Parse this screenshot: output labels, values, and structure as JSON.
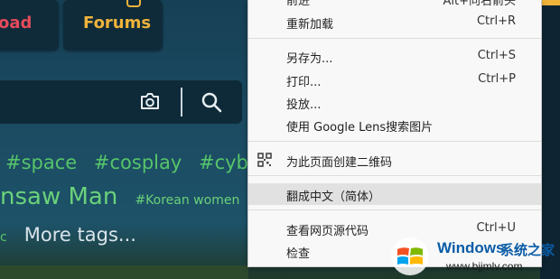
{
  "colors": {
    "page_bg": "#164055",
    "tag_green": "#56c46a",
    "menu_bg": "#f8f8f8",
    "menu_highlight": "#e1e1e1",
    "brand_blue": "#0a5ca6"
  },
  "nav_tiles": {
    "load_label": "oad",
    "forums_label": "Forums"
  },
  "tags": {
    "row1": [
      "#space",
      "#cosplay",
      "#cyberp"
    ],
    "row2_big": "nsaw Man",
    "row2_small": "#Korean women",
    "row3_small": "c",
    "more": "More tags..."
  },
  "context_menu": {
    "partial_top": {
      "label": "前进",
      "shortcut": "Alt+向右箭头"
    },
    "items": [
      {
        "label": "重新加载",
        "shortcut": "Ctrl+R"
      },
      {
        "label": "另存为...",
        "shortcut": "Ctrl+S"
      },
      {
        "label": "打印...",
        "shortcut": "Ctrl+P"
      },
      {
        "label": "投放...",
        "shortcut": ""
      },
      {
        "label": "使用 Google Lens搜索图片",
        "shortcut": ""
      },
      {
        "label": "为此页面创建二维码",
        "shortcut": "",
        "icon": "qr-code-icon"
      },
      {
        "label": "翻成中文（简体）",
        "shortcut": "",
        "highlighted": true
      },
      {
        "label": "查看网页源代码",
        "shortcut": "Ctrl+U"
      },
      {
        "label": "检查",
        "shortcut": ""
      }
    ]
  },
  "watermark": {
    "brand": "Windows",
    "site_cn": "系统之家",
    "url": "www.bjjmlv.com"
  },
  "icons": {
    "camera": "camera-icon",
    "search": "search-icon",
    "qr": "qr-code-icon",
    "windows": "windows-logo-icon"
  }
}
